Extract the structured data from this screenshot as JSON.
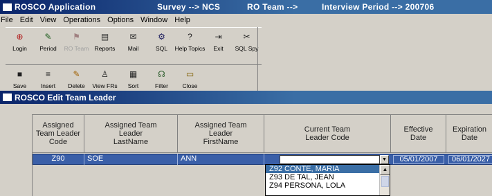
{
  "titlebar": {
    "app": "ROSCO Application",
    "survey": "Survey --> NCS",
    "ro_team": "RO Team -->",
    "interview": "Interview Period --> 200706"
  },
  "menu": [
    "File",
    "Edit",
    "View",
    "Operations",
    "Options",
    "Window",
    "Help"
  ],
  "toolbar_row1": [
    {
      "label": "Login",
      "icon": "login-icon",
      "glyph": "⊕",
      "color": "#b01818",
      "enabled": true
    },
    {
      "label": "Period",
      "icon": "period-icon",
      "glyph": "✎",
      "color": "#1a5a1a",
      "enabled": true
    },
    {
      "label": "RO Team",
      "icon": "ro-team-icon",
      "glyph": "⚑",
      "color": "#a08080",
      "enabled": false
    },
    {
      "label": "Reports",
      "icon": "reports-icon",
      "glyph": "▤",
      "color": "#303030",
      "enabled": true
    },
    {
      "label": "Mail",
      "icon": "mail-icon",
      "glyph": "✉",
      "color": "#2a2a2a",
      "enabled": true
    },
    {
      "label": "SQL",
      "icon": "sql-icon",
      "glyph": "⚙",
      "color": "#202060",
      "enabled": true
    },
    {
      "label": "Help Topics",
      "icon": "help-topics-icon",
      "glyph": "?",
      "color": "#202020",
      "enabled": true
    },
    {
      "label": "Exit",
      "icon": "exit-icon",
      "glyph": "⇥",
      "color": "#202020",
      "enabled": true
    },
    {
      "label": "SQL Spy",
      "icon": "sql-spy-icon",
      "glyph": "✂",
      "color": "#202020",
      "enabled": true
    }
  ],
  "toolbar_row2": [
    {
      "label": "Save",
      "icon": "save-icon",
      "glyph": "■",
      "color": "#202020",
      "enabled": true
    },
    {
      "label": "Insert",
      "icon": "insert-icon",
      "glyph": "≡",
      "color": "#202020",
      "enabled": true
    },
    {
      "label": "Delete",
      "icon": "delete-icon",
      "glyph": "✎",
      "color": "#a06000",
      "enabled": true
    },
    {
      "label": "View FRs",
      "icon": "view-frs-icon",
      "glyph": "♙",
      "color": "#202020",
      "enabled": true
    },
    {
      "label": "Sort",
      "icon": "sort-icon",
      "glyph": "▦",
      "color": "#202020",
      "enabled": true
    },
    {
      "label": "Filter",
      "icon": "filter-icon",
      "glyph": "☊",
      "color": "#306030",
      "enabled": true
    },
    {
      "label": "Close",
      "icon": "close-icon",
      "glyph": "▭",
      "color": "#806000",
      "enabled": true
    }
  ],
  "child_window": {
    "title": "ROSCO Edit Team Leader"
  },
  "grid": {
    "headers": {
      "code": "Assigned\nTeam Leader\nCode",
      "last": "Assigned Team\nLeader\nLastName",
      "first": "Assigned Team\nLeader\nFirstName",
      "current": "Current Team\nLeader Code",
      "effective": "Effective\nDate",
      "expiration": "Expiration\nDate"
    },
    "row": {
      "code": "Z90",
      "last": "SOE",
      "first": "ANN",
      "current": "",
      "effective": "05/01/2007",
      "expiration": "06/01/2027"
    }
  },
  "dropdown": {
    "options": [
      "Z92  CONTE, MARIA",
      "Z93  DE TAL, JEAN",
      "Z94  PERSONA, LOLA"
    ],
    "selected_index": 0
  }
}
